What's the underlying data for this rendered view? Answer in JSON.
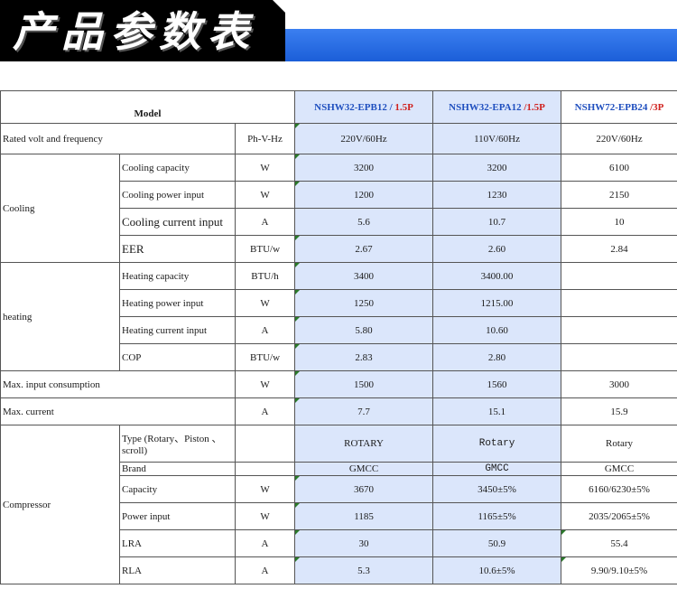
{
  "banner": {
    "title": "产品参数表"
  },
  "headers": {
    "model": "Model",
    "m1": "NSHW32-EPB12",
    "m1_sep": " / ",
    "m1_cap": "1.5P",
    "m2": "NSHW32-EPA12",
    "m2_sep": " /",
    "m2_cap": "1.5P",
    "m3": "NSHW72-EPB24",
    "m3_sep": " /",
    "m3_cap": "3P"
  },
  "rows": {
    "rated": {
      "label": "Rated volt and frequency",
      "unit": "Ph-V-Hz",
      "v1": "220V/60Hz",
      "v2": "110V/60Hz",
      "v3": "220V/60Hz"
    },
    "cooling": {
      "group": "Cooling",
      "capacity": {
        "label": "Cooling capacity",
        "unit": "W",
        "v1": "3200",
        "v2": "3200",
        "v3": "6100"
      },
      "power": {
        "label": "Cooling power input",
        "unit": "W",
        "v1": "1200",
        "v2": "1230",
        "v3": "2150"
      },
      "current": {
        "label": "Cooling current input",
        "unit": "A",
        "v1": "5.6",
        "v2": "10.7",
        "v3": "10"
      },
      "eer": {
        "label": "EER",
        "unit": "BTU/w",
        "v1": "2.67",
        "v2": "2.60",
        "v3": "2.84"
      }
    },
    "heating": {
      "group": "heating",
      "capacity": {
        "label": "Heating capacity",
        "unit": "BTU/h",
        "v1": "3400",
        "v2": "3400.00",
        "v3": ""
      },
      "power": {
        "label": "Heating power input",
        "unit": "W",
        "v1": "1250",
        "v2": "1215.00",
        "v3": ""
      },
      "current": {
        "label": "Heating current input",
        "unit": "A",
        "v1": "5.80",
        "v2": "10.60",
        "v3": ""
      },
      "cop": {
        "label": "COP",
        "unit": "BTU/w",
        "v1": "2.83",
        "v2": "2.80",
        "v3": ""
      }
    },
    "max_input": {
      "label": "Max. input consumption",
      "unit": "W",
      "v1": "1500",
      "v2": "1560",
      "v3": "3000"
    },
    "max_current": {
      "label": "Max. current",
      "unit": "A",
      "v1": "7.7",
      "v2": "15.1",
      "v3": "15.9"
    },
    "compressor": {
      "group": "Compressor",
      "type": {
        "label": "Type (Rotary、Piston 、 scroll)",
        "unit": "",
        "v1": "ROTARY",
        "v2": "Rotary",
        "v3": "Rotary"
      },
      "brand": {
        "label": "Brand",
        "unit": "",
        "v1": "GMCC",
        "v2": "GMCC",
        "v3": "GMCC"
      },
      "capacity": {
        "label": "Capacity",
        "unit": "W",
        "v1": "3670",
        "v2": "3450±5%",
        "v3": "6160/6230±5%"
      },
      "power": {
        "label": "Power input",
        "unit": "W",
        "v1": "1185",
        "v2": "1165±5%",
        "v3": "2035/2065±5%"
      },
      "lra": {
        "label": "LRA",
        "unit": "A",
        "v1": "30",
        "v2": "50.9",
        "v3": "55.4"
      },
      "rla": {
        "label": "RLA",
        "unit": "A",
        "v1": "5.3",
        "v2": "10.6±5%",
        "v3": "9.90/9.10±5%"
      }
    }
  }
}
